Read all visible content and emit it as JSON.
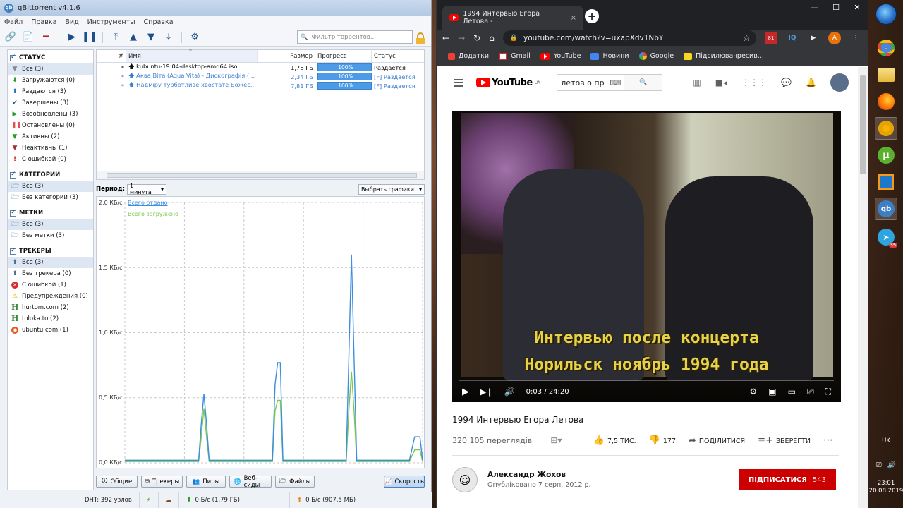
{
  "qbt": {
    "title": "qBittorrent v4.1.6",
    "menu": [
      "Файл",
      "Правка",
      "Вид",
      "Инструменты",
      "Справка"
    ],
    "filter_placeholder": "Фильтр торрентов...",
    "sidebar": {
      "status_header": "СТАТУС",
      "status": [
        "Все (3)",
        "Загружаются (0)",
        "Раздаются (3)",
        "Завершены (3)",
        "Возобновлены (3)",
        "Остановлены (0)",
        "Активны (2)",
        "Неактивны (1)",
        "С ошибкой (0)"
      ],
      "categories_header": "КАТЕГОРИИ",
      "categories": [
        "Все (3)",
        "Без категории (3)"
      ],
      "tags_header": "МЕТКИ",
      "tags": [
        "Все (3)",
        "Без метки (3)"
      ],
      "trackers_header": "ТРЕКЕРЫ",
      "trackers": [
        "Все (3)",
        "Без трекера (0)",
        "С ошибкой (1)",
        "Предупреждения (0)",
        "hurtom.com (2)",
        "toloka.to (2)",
        "ubuntu.com (1)"
      ]
    },
    "columns": {
      "num": "#",
      "name": "Имя",
      "size": "Размер",
      "progress": "Прогресс",
      "status": "Статус"
    },
    "torrents": [
      {
        "num": "*",
        "name": "kubuntu-19.04-desktop-amd64.iso",
        "size": "1,78 ГБ",
        "progress": "100%",
        "status": "Раздается"
      },
      {
        "num": "*",
        "name": "Аква Віта (Aqua Vita) - Дискографія (...",
        "size": "2,34 ГБ",
        "progress": "100%",
        "status": "[F] Раздается"
      },
      {
        "num": "*",
        "name": "Надміру турботливе хвостате Божес...",
        "size": "7,81 ГБ",
        "progress": "100%",
        "status": "[F] Раздается"
      }
    ],
    "period_label": "Период:",
    "period_value": "1 минута",
    "select_graphs": "Выбрать графики",
    "tabs": [
      "Общие",
      "Трекеры",
      "Пиры",
      "Веб-сиды",
      "Файлы"
    ],
    "speed_button": "Скорость",
    "status_dht": "DHT: 392 узлов",
    "status_down": "0 Б/с (1,79 ГБ)",
    "status_up": "0 Б/с (907,5 МБ)"
  },
  "chart_data": {
    "type": "line",
    "y_ticks": [
      "2,0 КБ/с",
      "1,5 КБ/с",
      "1,0 КБ/с",
      "0,5 КБ/с",
      "0,0 КБ/с"
    ],
    "ylim": [
      0,
      2.0
    ],
    "grid": true,
    "legend_position": "top-left",
    "series": [
      {
        "name": "Всего отдано",
        "color": "#3c8ee0",
        "x": [
          0,
          28,
          29,
          30,
          31,
          32,
          56,
          57,
          58,
          59,
          60,
          84,
          85,
          86,
          87,
          88,
          108,
          110,
          112,
          113
        ],
        "values": [
          0.02,
          0.02,
          0.3,
          0.53,
          0.3,
          0.02,
          0.02,
          0.6,
          0.77,
          0.77,
          0.02,
          0.02,
          0.8,
          1.6,
          0.8,
          0.02,
          0.02,
          0.2,
          0.2,
          0.02
        ]
      },
      {
        "name": "Всего загружено",
        "color": "#7ac94a",
        "x": [
          0,
          28,
          29,
          30,
          31,
          32,
          56,
          57,
          58,
          59,
          60,
          84,
          85,
          86,
          87,
          88,
          108,
          110,
          112,
          113
        ],
        "values": [
          0.01,
          0.01,
          0.2,
          0.42,
          0.2,
          0.01,
          0.01,
          0.4,
          0.48,
          0.48,
          0.01,
          0.01,
          0.4,
          0.7,
          0.4,
          0.01,
          0.01,
          0.1,
          0.1,
          0.01
        ]
      }
    ]
  },
  "chrome": {
    "tab_title": "1994 Интервью Егора Летова -",
    "tab_close": "×",
    "url": "youtube.com/watch?v=uxapXdv1NbY",
    "ext_badge": "81",
    "ext_iq": "IQ",
    "profile": "A",
    "bookmarks": [
      "Додатки",
      "Gmail",
      "YouTube",
      "Новини",
      "Google",
      "Підсилювачресив..."
    ],
    "bookmark_colors": [
      "#e94235",
      "#d93025",
      "#ff0000",
      "#4285f4",
      "#34a853",
      "#f9d71c"
    ]
  },
  "youtube": {
    "logo_text": "YouTube",
    "logo_region": "UA",
    "search_value": "летов о пр",
    "subtitle_line1": "Интервью после концерта",
    "subtitle_line2": "Норильск ноябрь 1994 года",
    "time": "0:03 / 24:20",
    "video_title": "1994 Интервью Егора Летова",
    "views": "320 105 переглядів",
    "likes": "7,5 ТИС.",
    "dislikes": "177",
    "share": "ПОДІЛИТИСЯ",
    "save": "ЗБЕРЕГТИ",
    "more": "⋯",
    "channel": "Александр Жохов",
    "published": "Опубліковано 7 серп. 2012 р.",
    "subscribe": "ПІДПИСАТИСЯ",
    "subscribers": "543"
  },
  "taskbar": {
    "lang": "UK",
    "time": "23:01",
    "date": "20.08.2019",
    "telegram_badge": "35"
  }
}
